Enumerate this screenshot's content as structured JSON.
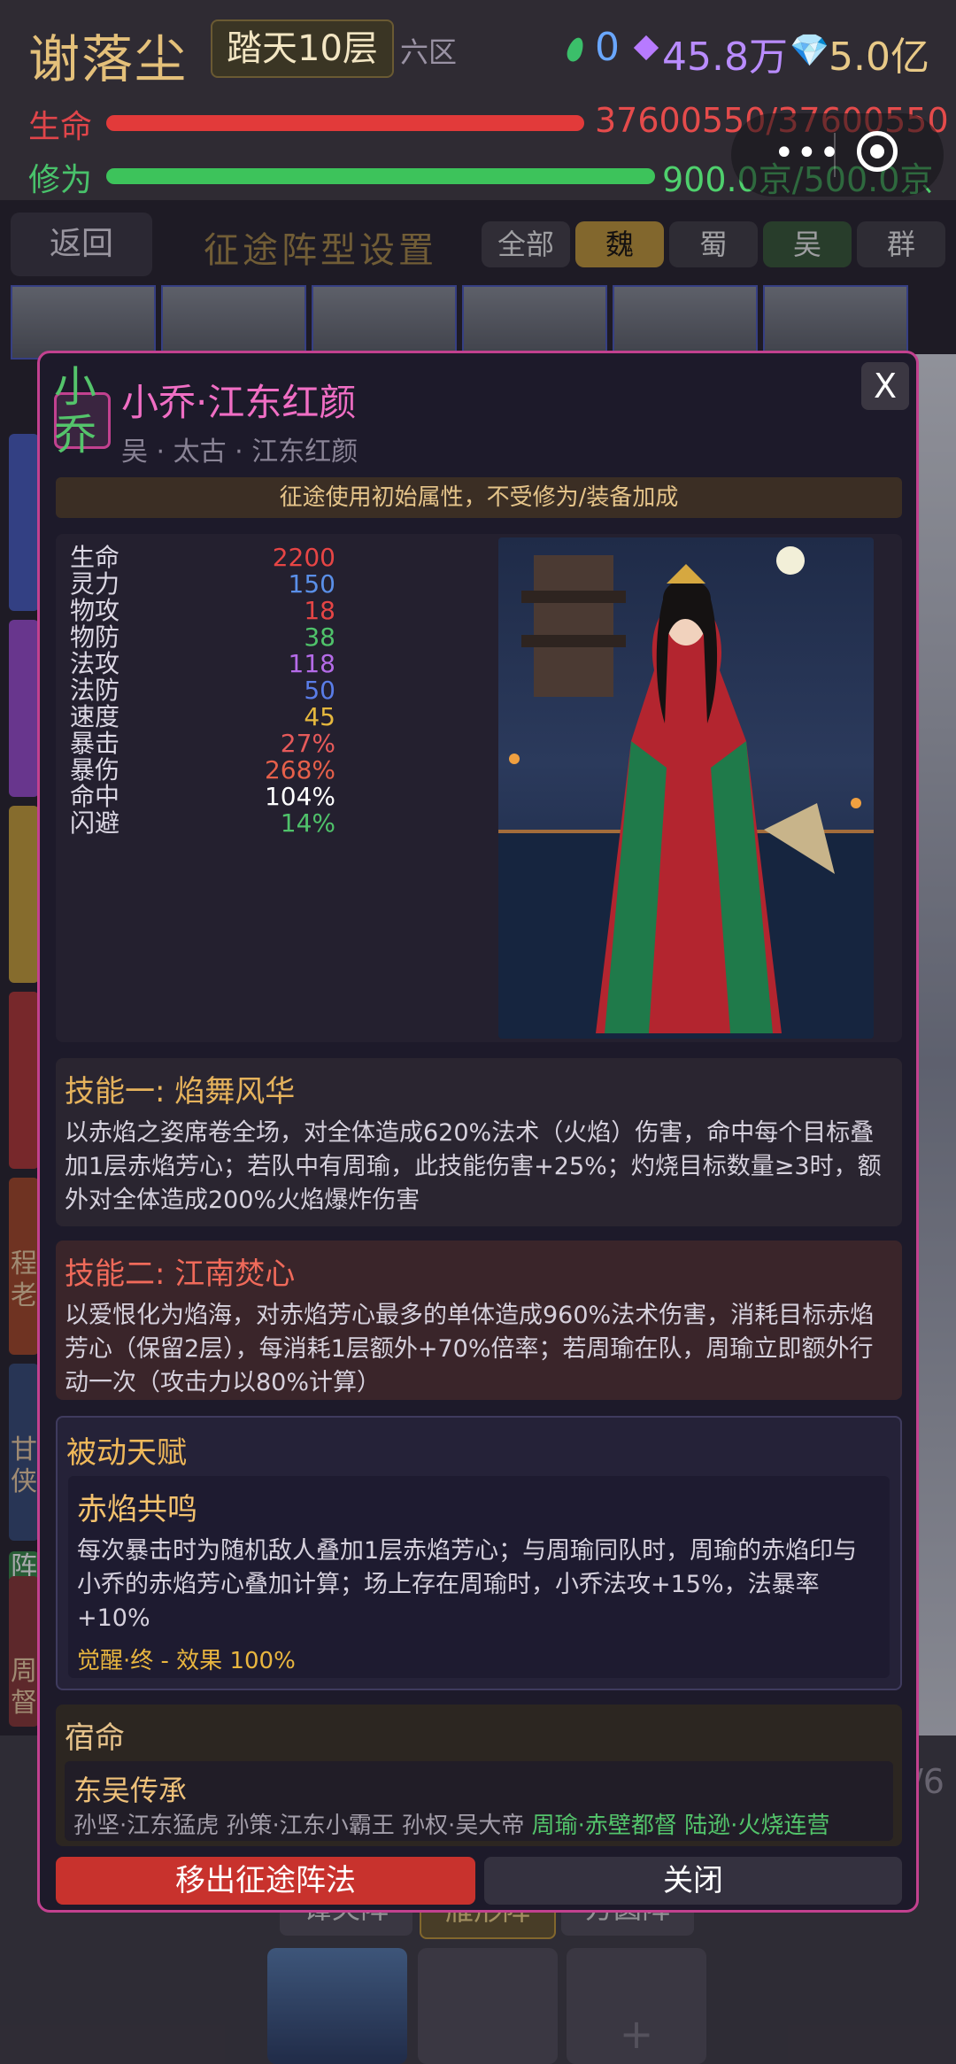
{
  "header": {
    "player_name": "谢落尘",
    "realm": "踏天10层",
    "zone": "六区",
    "currency": {
      "green_value": "0",
      "purple_value": "45.8万",
      "diamond_value": "5.0亿",
      "diamond_icon": "💎"
    },
    "hp": {
      "label": "生命",
      "text": "37600550/37600550",
      "fill_fraction": 1.0
    },
    "cultivation": {
      "label": "修为",
      "text": "900.0京/500.0京",
      "fill_fraction": 1.0
    },
    "capsule": {
      "dots": "•••"
    }
  },
  "nav": {
    "back_label": "返回",
    "title": "征途阵型设置",
    "filters": [
      "全部",
      "魏",
      "蜀",
      "吴",
      "群"
    ],
    "selected_filter": "魏"
  },
  "side": {
    "labels": [
      "程老",
      "甘侠",
      "阵",
      "周督"
    ]
  },
  "bottom": {
    "tabs": [
      "锋矢阵",
      "雁形阵",
      "方圆阵"
    ],
    "plus": "+",
    "page_fraction": "/6"
  },
  "modal": {
    "avatar_chars": [
      "小",
      "乔"
    ],
    "hero_name": "小乔·江东红颜",
    "subtitle": "吴 · 太古 · 江东红颜",
    "close_x": "X",
    "notice": "征途使用初始属性，不受修为/装备加成",
    "stats": [
      {
        "name": "生命",
        "value": "2200",
        "color": "#e64545"
      },
      {
        "name": "灵力",
        "value": "150",
        "color": "#5a8fe8"
      },
      {
        "name": "物攻",
        "value": "18",
        "color": "#e64545"
      },
      {
        "name": "物防",
        "value": "38",
        "color": "#4fc26a"
      },
      {
        "name": "法攻",
        "value": "118",
        "color": "#b56be8"
      },
      {
        "name": "法防",
        "value": "50",
        "color": "#5a7de8"
      },
      {
        "name": "速度",
        "value": "45",
        "color": "#e6b83e"
      },
      {
        "name": "暴击",
        "value": "27%",
        "color": "#e65a5a"
      },
      {
        "name": "暴伤",
        "value": "268%",
        "color": "#e6604a"
      },
      {
        "name": "命中",
        "value": "104%",
        "color": "#ffffff"
      },
      {
        "name": "闪避",
        "value": "14%",
        "color": "#4fc26a"
      }
    ],
    "skill1": {
      "title": "技能一: 焰舞风华",
      "desc": "以赤焰之姿席卷全场，对全体造成620%法术（火焰）伤害，命中每个目标叠加1层赤焰芳心；若队中有周瑜，此技能伤害+25%；灼烧目标数量≥3时，额外对全体造成200%火焰爆炸伤害"
    },
    "skill2": {
      "title": "技能二: 江南焚心",
      "desc": "以爱恨化为焰海，对赤焰芳心最多的单体造成960%法术伤害，消耗目标赤焰芳心（保留2层），每消耗1层额外+70%倍率；若周瑜在队，周瑜立即额外行动一次（攻击力以80%计算）"
    },
    "passive": {
      "header": "被动天赋",
      "name": "赤焰共鸣",
      "desc": "每次暴击时为随机敌人叠加1层赤焰芳心；与周瑜同队时，周瑜的赤焰印与小乔的赤焰芳心叠加计算；场上存在周瑜时，小乔法攻+15%，法暴率+10%",
      "level": "觉醒·终 - 效果 100%"
    },
    "fate": {
      "header": "宿命",
      "name": "东吴传承",
      "inactive_members": "孙坚·江东猛虎 孙策·江东小霸王 孙权·吴大帝",
      "active_members": "周瑜·赤壁都督 陆逊·火烧连营"
    },
    "remove_label": "移出征途阵法",
    "close_label": "关闭"
  }
}
